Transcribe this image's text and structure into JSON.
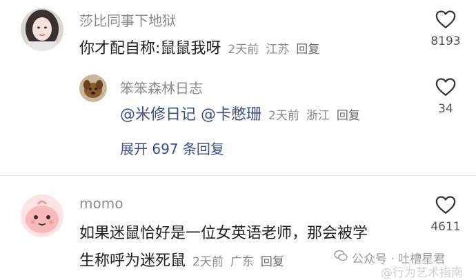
{
  "comments": [
    {
      "username": "莎比同事下地狱",
      "text": "你才配自称:鼠鼠我呀",
      "time": "2天前",
      "location": "江苏",
      "reply_label": "回复",
      "likes": "8193",
      "avatar_icon": "girl-portrait-avatar"
    },
    {
      "username": "momo",
      "text_line1": "如果迷鼠恰好是一位女英语老师，那会被学",
      "text_line2": "生称呼为迷死鼠",
      "time": "2天前",
      "location": "广东",
      "reply_label": "回复",
      "likes": "4611",
      "avatar_icon": "pink-cartoon-avatar"
    }
  ],
  "reply": {
    "username": "笨笨森林日志",
    "mention1": "@米修日记",
    "mention2": "@卡憋珊",
    "time": "2天前",
    "location": "浙江",
    "reply_label": "回复",
    "likes": "34",
    "avatar_icon": "puppy-avatar"
  },
  "expand_label": "展开 697 条回复",
  "watermark": {
    "wechat": "公众号 · 吐槽星君",
    "weibo": "@行为艺术指南"
  },
  "colors": {
    "username_gray": "#8a8a8a",
    "mention_blue": "#3b4f86",
    "text_dark": "#1f1f1f"
  }
}
